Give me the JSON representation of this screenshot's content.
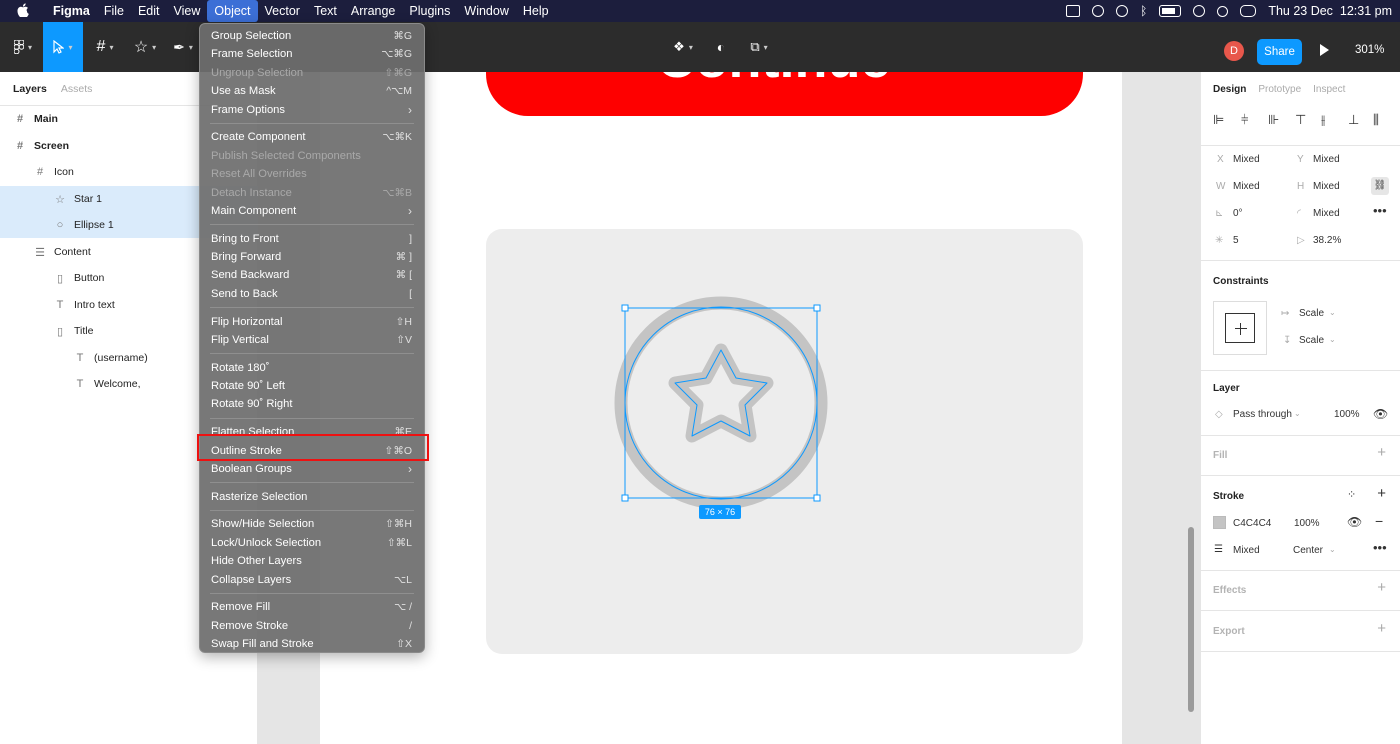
{
  "menubar": {
    "apple": "",
    "items": [
      {
        "label": "Figma",
        "app": true
      },
      {
        "label": "File"
      },
      {
        "label": "Edit"
      },
      {
        "label": "View"
      },
      {
        "label": "Object",
        "active": true
      },
      {
        "label": "Vector"
      },
      {
        "label": "Text"
      },
      {
        "label": "Arrange"
      },
      {
        "label": "Plugins"
      },
      {
        "label": "Window"
      },
      {
        "label": "Help"
      }
    ],
    "datetime": "Thu 23 Dec  12:31 pm"
  },
  "toolbar": {
    "avatar_initial": "D",
    "share_label": "Share",
    "zoom_level": "301%"
  },
  "left_panel": {
    "tabs": [
      "Layers",
      "Assets"
    ],
    "layers": [
      {
        "name": "Main",
        "icon": "#",
        "indent": 0,
        "bold": true,
        "selected": false
      },
      {
        "name": "Screen",
        "icon": "#",
        "indent": 0,
        "bold": true,
        "selected": false
      },
      {
        "name": "Icon",
        "icon": "#",
        "indent": 1,
        "bold": false,
        "selected": false
      },
      {
        "name": "Star 1",
        "icon": "☆",
        "indent": 2,
        "bold": false,
        "selected": true
      },
      {
        "name": "Ellipse 1",
        "icon": "○",
        "indent": 2,
        "bold": false,
        "selected": true
      },
      {
        "name": "Content",
        "icon": "☰",
        "indent": 1,
        "bold": false,
        "selected": false
      },
      {
        "name": "Button",
        "icon": "▯",
        "indent": 2,
        "bold": false,
        "selected": false
      },
      {
        "name": "Intro text",
        "icon": "T",
        "indent": 2,
        "bold": false,
        "selected": false
      },
      {
        "name": "Title",
        "icon": "▯",
        "indent": 2,
        "bold": false,
        "selected": false
      },
      {
        "name": "(username)",
        "icon": "T",
        "indent": 3,
        "bold": false,
        "selected": false
      },
      {
        "name": "Welcome,",
        "icon": "T",
        "indent": 3,
        "bold": false,
        "selected": false
      }
    ]
  },
  "canvas": {
    "button_text": "Continue",
    "selection_size": "76 × 76",
    "colors": {
      "button": "#fe0000",
      "selection": "#0d99ff",
      "icon_stroke": "#c4c4c4"
    }
  },
  "object_menu": {
    "items": [
      {
        "label": "Group Selection",
        "shortcut": "⌘G",
        "disabled": false
      },
      {
        "label": "Frame Selection",
        "shortcut": "⌥⌘G",
        "disabled": false
      },
      {
        "label": "Ungroup Selection",
        "shortcut": "⇧⌘G",
        "disabled": true
      },
      {
        "label": "Use as Mask",
        "shortcut": "^⌥M",
        "disabled": false
      },
      {
        "label": "Frame Options",
        "shortcut": "›",
        "disabled": false,
        "submenu": true
      },
      {
        "sep": true
      },
      {
        "label": "Create Component",
        "shortcut": "⌥⌘K",
        "disabled": false
      },
      {
        "label": "Publish Selected Components",
        "shortcut": "",
        "disabled": true
      },
      {
        "label": "Reset All Overrides",
        "shortcut": "",
        "disabled": true
      },
      {
        "label": "Detach Instance",
        "shortcut": "⌥⌘B",
        "disabled": true
      },
      {
        "label": "Main Component",
        "shortcut": "›",
        "disabled": false,
        "submenu": true
      },
      {
        "sep": true
      },
      {
        "label": "Bring to Front",
        "shortcut": "]",
        "disabled": false
      },
      {
        "label": "Bring Forward",
        "shortcut": "⌘ ]",
        "disabled": false
      },
      {
        "label": "Send Backward",
        "shortcut": "⌘ [",
        "disabled": false
      },
      {
        "label": "Send to Back",
        "shortcut": "[",
        "disabled": false
      },
      {
        "sep": true
      },
      {
        "label": "Flip Horizontal",
        "shortcut": "⇧H",
        "disabled": false
      },
      {
        "label": "Flip Vertical",
        "shortcut": "⇧V",
        "disabled": false
      },
      {
        "sep": true
      },
      {
        "label": "Rotate 180˚",
        "shortcut": "",
        "disabled": false
      },
      {
        "label": "Rotate 90˚ Left",
        "shortcut": "",
        "disabled": false
      },
      {
        "label": "Rotate 90˚ Right",
        "shortcut": "",
        "disabled": false
      },
      {
        "sep": true
      },
      {
        "label": "Flatten Selection",
        "shortcut": "⌘E",
        "disabled": false
      },
      {
        "label": "Outline Stroke",
        "shortcut": "⇧⌘O",
        "disabled": false,
        "highlighted": true
      },
      {
        "label": "Boolean Groups",
        "shortcut": "›",
        "disabled": false,
        "submenu": true
      },
      {
        "sep": true
      },
      {
        "label": "Rasterize Selection",
        "shortcut": "",
        "disabled": false
      },
      {
        "sep": true
      },
      {
        "label": "Show/Hide Selection",
        "shortcut": "⇧⌘H",
        "disabled": false
      },
      {
        "label": "Lock/Unlock Selection",
        "shortcut": "⇧⌘L",
        "disabled": false
      },
      {
        "label": "Hide Other Layers",
        "shortcut": "",
        "disabled": false
      },
      {
        "label": "Collapse Layers",
        "shortcut": "⌥L",
        "disabled": false
      },
      {
        "sep": true
      },
      {
        "label": "Remove Fill",
        "shortcut": "⌥ /",
        "disabled": false
      },
      {
        "label": "Remove Stroke",
        "shortcut": "/",
        "disabled": false
      },
      {
        "label": "Swap Fill and Stroke",
        "shortcut": "⇧X",
        "disabled": false
      }
    ]
  },
  "right_panel": {
    "tabs": [
      "Design",
      "Prototype",
      "Inspect"
    ],
    "x_label": "X",
    "x_value": "Mixed",
    "y_label": "Y",
    "y_value": "Mixed",
    "w_label": "W",
    "w_value": "Mixed",
    "h_label": "H",
    "h_value": "Mixed",
    "rotation": "0°",
    "radius": "Mixed",
    "points": "5",
    "ratio": "38.2%",
    "constraints_title": "Constraints",
    "constraint_h": "Scale",
    "constraint_v": "Scale",
    "layer_title": "Layer",
    "blend": "Pass through",
    "opacity": "100%",
    "fill_title": "Fill",
    "stroke_title": "Stroke",
    "stroke_color": "C4C4C4",
    "stroke_opacity": "100%",
    "stroke_weight": "Mixed",
    "stroke_align": "Center",
    "effects_title": "Effects",
    "export_title": "Export"
  }
}
